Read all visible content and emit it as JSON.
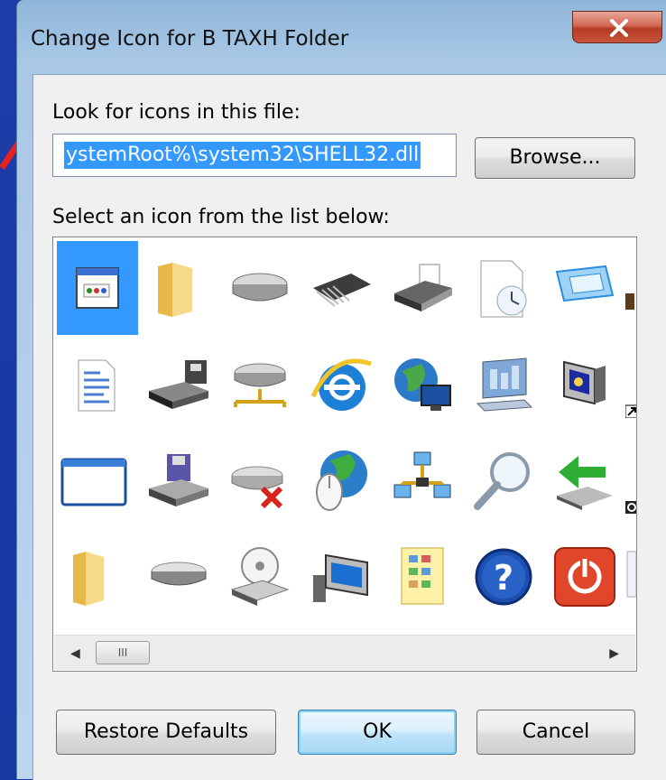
{
  "window": {
    "title": "Change Icon for B TAXH Folder",
    "close_label": "X"
  },
  "file_section": {
    "label": "Look for icons in this file:",
    "path_value": "ystemRoot%\\system32\\SHELL32.dll",
    "browse_label": "Browse..."
  },
  "list_section": {
    "label": "Select an icon from the list below:",
    "icons": [
      "application-window-icon",
      "folder-icon",
      "drive-icon",
      "chip-icon",
      "printer-icon",
      "clock-document-icon",
      "monitor-blue-icon",
      "partial-icon",
      "document-icon",
      "floppy-drive-icon",
      "network-drive-icon",
      "internet-explorer-icon",
      "globe-network-icon",
      "monitor-chart-icon",
      "speaker-monitor-icon",
      "shortcut-arrow-icon",
      "blank-window-icon",
      "floppy-disk-drive-icon",
      "disconnected-drive-icon",
      "globe-mouse-icon",
      "network-computers-icon",
      "magnifier-icon",
      "green-arrow-drive-icon",
      "clock-overlay-icon",
      "folder-icon",
      "drive-icon",
      "cd-drive-icon",
      "computer-monitor-icon",
      "control-panel-icon",
      "help-icon",
      "power-icon",
      "partial-icon"
    ],
    "scroll_thumb_label": "III"
  },
  "buttons": {
    "restore_label": "Restore Defaults",
    "ok_label": "OK",
    "cancel_label": "Cancel"
  },
  "colors": {
    "selection": "#3399ff",
    "close_button": "#c8543b",
    "annotation_arrow": "#e8201c"
  }
}
